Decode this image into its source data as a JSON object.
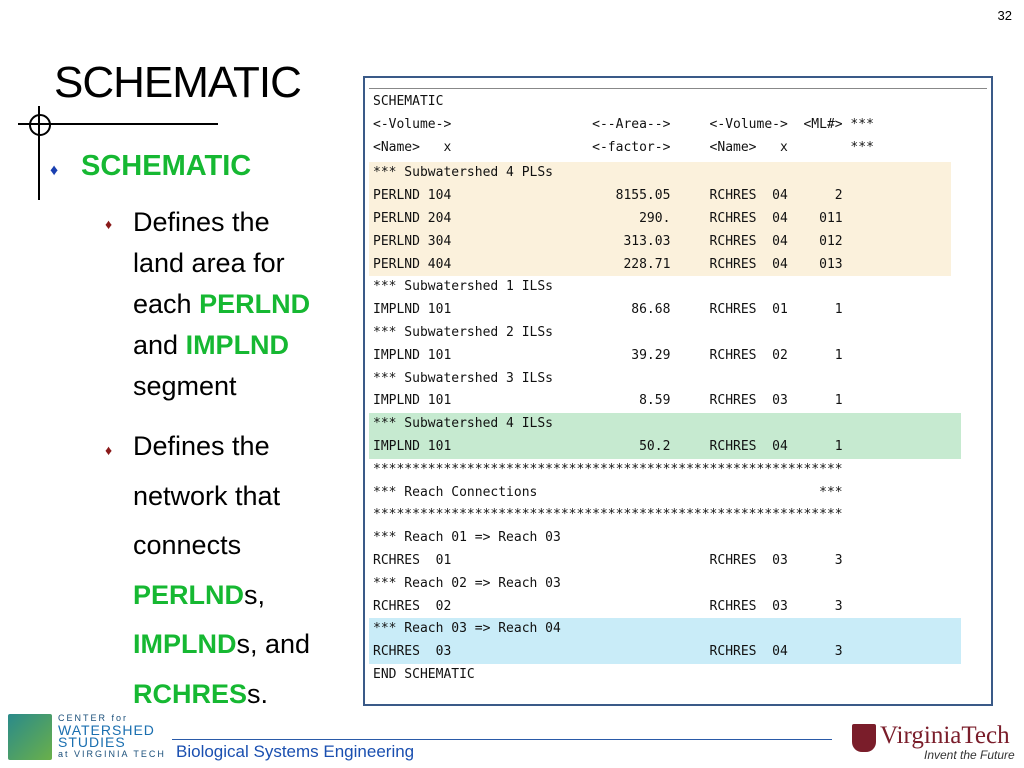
{
  "page_number": "32",
  "title": "SCHEMATIC",
  "bullets": {
    "main": "SCHEMATIC",
    "sub1": {
      "line1": "Defines the",
      "line2": "land area for",
      "line3a": "each ",
      "line3b": "PERLND",
      "line4a": "and ",
      "line4b": "IMPLND",
      "line5": "segment"
    },
    "sub2": {
      "line1": "Defines the",
      "line2": "network that",
      "line3": "connects",
      "line4a": "PERLND",
      "line4b": "s,",
      "line5a": "IMPLND",
      "line5b": "s, and",
      "line6a": "RCHRES",
      "line6b": "s."
    }
  },
  "code": [
    "SCHEMATIC",
    "<-Volume->                  <--Area-->     <-Volume->  <ML#> ***",
    "<Name>   x                  <-factor->     <Name>   x        ***",
    "*** Subwatershed 4 PLSs",
    "PERLND 104                     8155.05     RCHRES  04      2",
    "PERLND 204                        290.     RCHRES  04    011",
    "PERLND 304                      313.03     RCHRES  04    012",
    "PERLND 404                      228.71     RCHRES  04    013",
    "*** Subwatershed 1 ILSs",
    "IMPLND 101                       86.68     RCHRES  01      1",
    "*** Subwatershed 2 ILSs",
    "IMPLND 101                       39.29     RCHRES  02      1",
    "*** Subwatershed 3 ILSs",
    "IMPLND 101                        8.59     RCHRES  03      1",
    "*** Subwatershed 4 ILSs",
    "IMPLND 101                        50.2     RCHRES  04      1",
    "************************************************************",
    "*** Reach Connections                                    ***",
    "************************************************************",
    "*** Reach 01 => Reach 03",
    "RCHRES  01                                 RCHRES  03      3",
    "*** Reach 02 => Reach 03",
    "RCHRES  02                                 RCHRES  03      3",
    "*** Reach 03 => Reach 04",
    "RCHRES  03                                 RCHRES  04      3",
    "END SCHEMATIC"
  ],
  "highlight_colors": {
    "tan": "#fbf1dc",
    "green": "#c6ead0",
    "blue": "#c9ecf8"
  },
  "footer": {
    "department": "Biological Systems Engineering",
    "cws_line1": "CENTER for",
    "cws_line2": "WATERSHED",
    "cws_line3": "STUDIES",
    "cws_line4": "at VIRGINIA TECH",
    "vt_name": "VirginiaTech",
    "vt_tagline": "Invent the Future"
  }
}
